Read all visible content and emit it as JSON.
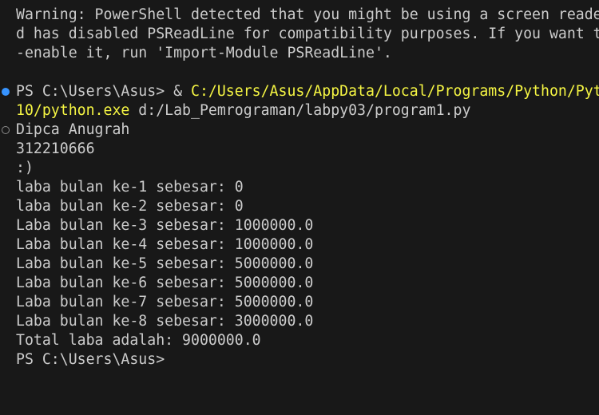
{
  "warning": {
    "line1": "Warning: PowerShell detected that you might be using a screen reade",
    "line2": "d has disabled PSReadLine for compatibility purposes. If you want t",
    "line3": "-enable it, run 'Import-Module PSReadLine'."
  },
  "command": {
    "prompt": "PS C:\\Users\\Asus> & ",
    "exe_part1": "C:/Users/Asus/AppData/Local/Programs/Python/Pyt",
    "exe_part2": "10/python.exe",
    "script": " d:/Lab_Pemrograman/labpy03/program1.py"
  },
  "output": [
    "Dipca Anugrah",
    "312210666",
    ":)",
    "laba bulan ke-1 sebesar: 0",
    "laba bulan ke-2 sebesar: 0",
    "Laba bulan ke-3 sebesar: 1000000.0",
    "Laba bulan ke-4 sebesar: 1000000.0",
    "Laba bulan ke-5 sebesar: 5000000.0",
    "Laba bulan ke-6 sebesar: 5000000.0",
    "Laba bulan ke-7 sebesar: 5000000.0",
    "Laba bulan ke-8 sebesar: 3000000.0",
    "Total laba adalah: 9000000.0"
  ],
  "final_prompt": "PS C:\\Users\\Asus>",
  "colors": {
    "background": "#181818",
    "text": "#cccccc",
    "highlight": "#f5f543",
    "decoration_success": "#3794ff",
    "decoration_default": "#8a8a8a"
  },
  "icons": {
    "command_decoration": "command-success-dot-icon",
    "output_decoration": "command-default-circle-icon"
  }
}
